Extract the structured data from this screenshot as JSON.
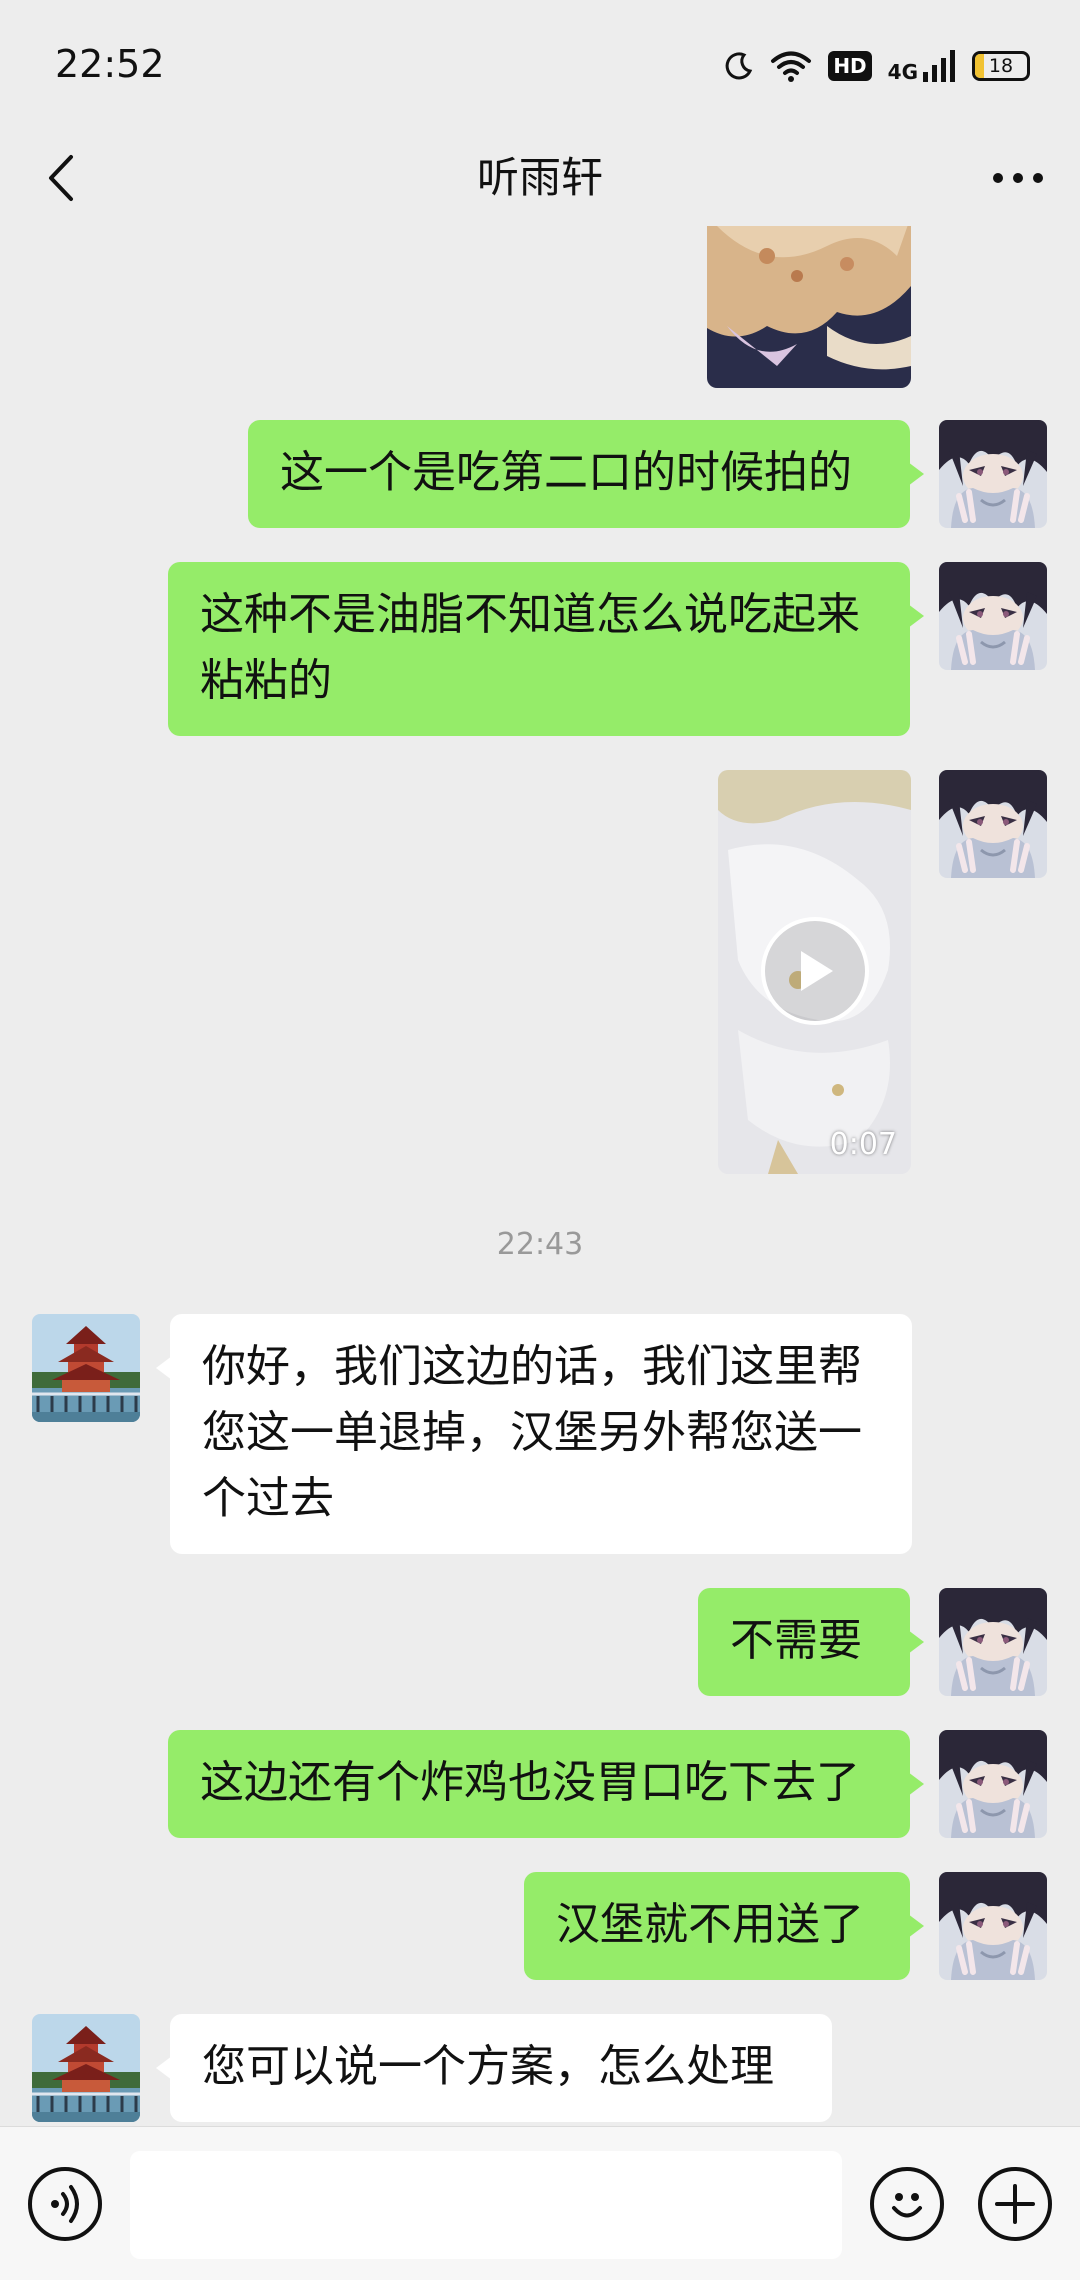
{
  "status_bar": {
    "time": "22:52",
    "network": "4G",
    "hd": "HD",
    "battery": "18",
    "battery_level": 0.18
  },
  "header": {
    "title": "听雨轩"
  },
  "messages": [
    {
      "type": "image",
      "sender": "me"
    },
    {
      "type": "text",
      "sender": "me",
      "text": "这一个是吃第二口的时候拍的"
    },
    {
      "type": "text",
      "sender": "me",
      "text": "这种不是油脂不知道怎么说吃起来粘粘的"
    },
    {
      "type": "video",
      "sender": "me",
      "duration": "0:07"
    },
    {
      "type": "time",
      "text": "22:43"
    },
    {
      "type": "text",
      "sender": "merchant",
      "text": "你好，我们这边的话，我们这里帮您这一单退掉，汉堡另外帮您送一个过去"
    },
    {
      "type": "text",
      "sender": "me",
      "text": "不需要"
    },
    {
      "type": "text",
      "sender": "me",
      "text": "这边还有个炸鸡也没胃口吃下去了"
    },
    {
      "type": "text",
      "sender": "me",
      "text": "汉堡就不用送了"
    },
    {
      "type": "text",
      "sender": "merchant",
      "text": "您可以说一个方案，怎么处理"
    }
  ],
  "colors": {
    "background": "#ededed",
    "my_bubble": "#95ec69",
    "their_bubble": "#ffffff",
    "battery_fill": "#f1c232"
  },
  "icons": {
    "back": "back-arrow-icon",
    "more": "more-dots-icon",
    "voice": "voice-icon",
    "emoji": "emoji-icon",
    "plus": "plus-icon",
    "play": "play-icon"
  }
}
